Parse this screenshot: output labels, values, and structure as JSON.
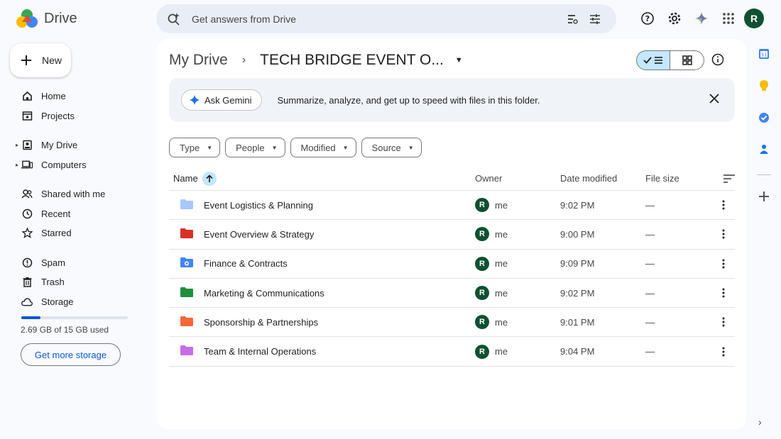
{
  "app": {
    "name": "Drive"
  },
  "search": {
    "placeholder": "Get answers from Drive"
  },
  "user": {
    "initial": "R",
    "avatar_color": "#0f5132"
  },
  "sidebar": {
    "new_label": "New",
    "items": [
      {
        "label": "Home",
        "icon": "home-icon"
      },
      {
        "label": "Projects",
        "icon": "projects-icon"
      },
      {
        "label": "My Drive",
        "icon": "my-drive-icon"
      },
      {
        "label": "Computers",
        "icon": "computers-icon"
      },
      {
        "label": "Shared with me",
        "icon": "shared-icon"
      },
      {
        "label": "Recent",
        "icon": "clock-icon"
      },
      {
        "label": "Starred",
        "icon": "star-icon"
      },
      {
        "label": "Spam",
        "icon": "spam-icon"
      },
      {
        "label": "Trash",
        "icon": "trash-icon"
      },
      {
        "label": "Storage",
        "icon": "cloud-icon"
      }
    ],
    "storage_text": "2.69 GB of 15 GB used",
    "storage_used_fraction": 0.18,
    "get_more_storage": "Get more storage"
  },
  "breadcrumb": {
    "root": "My Drive",
    "current": "TECH BRIDGE EVENT O..."
  },
  "gemini_banner": {
    "button_label": "Ask Gemini",
    "text": "Summarize, analyze, and get up to speed with files in this folder."
  },
  "filters": [
    "Type",
    "People",
    "Modified",
    "Source"
  ],
  "table": {
    "headers": {
      "name": "Name",
      "owner": "Owner",
      "date": "Date modified",
      "size": "File size"
    },
    "rows": [
      {
        "name": "Event Logistics & Planning",
        "owner": "me",
        "date": "9:02 PM",
        "size": "—",
        "color": "#a8c7fa",
        "icon": "folder-icon"
      },
      {
        "name": "Event Overview & Strategy",
        "owner": "me",
        "date": "9:00 PM",
        "size": "—",
        "color": "#d93025",
        "icon": "folder-icon"
      },
      {
        "name": "Finance & Contracts",
        "owner": "me",
        "date": "9:09 PM",
        "size": "—",
        "color": "#4285f4",
        "icon": "shared-folder-icon"
      },
      {
        "name": "Marketing & Communications",
        "owner": "me",
        "date": "9:02 PM",
        "size": "—",
        "color": "#1e8e3e",
        "icon": "folder-icon"
      },
      {
        "name": "Sponsorship & Partnerships",
        "owner": "me",
        "date": "9:01 PM",
        "size": "—",
        "color": "#f4683a",
        "icon": "folder-icon"
      },
      {
        "name": "Team & Internal Operations",
        "owner": "me",
        "date": "9:04 PM",
        "size": "—",
        "color": "#c76ee6",
        "icon": "folder-icon"
      }
    ]
  },
  "rail": {
    "apps": [
      "calendar-icon",
      "keep-icon",
      "tasks-icon",
      "contacts-icon"
    ],
    "calendar_day": "31"
  },
  "colors": {
    "accent": "#0b57d0",
    "selected": "#c2e7ff",
    "surface": "#f8fafd"
  }
}
